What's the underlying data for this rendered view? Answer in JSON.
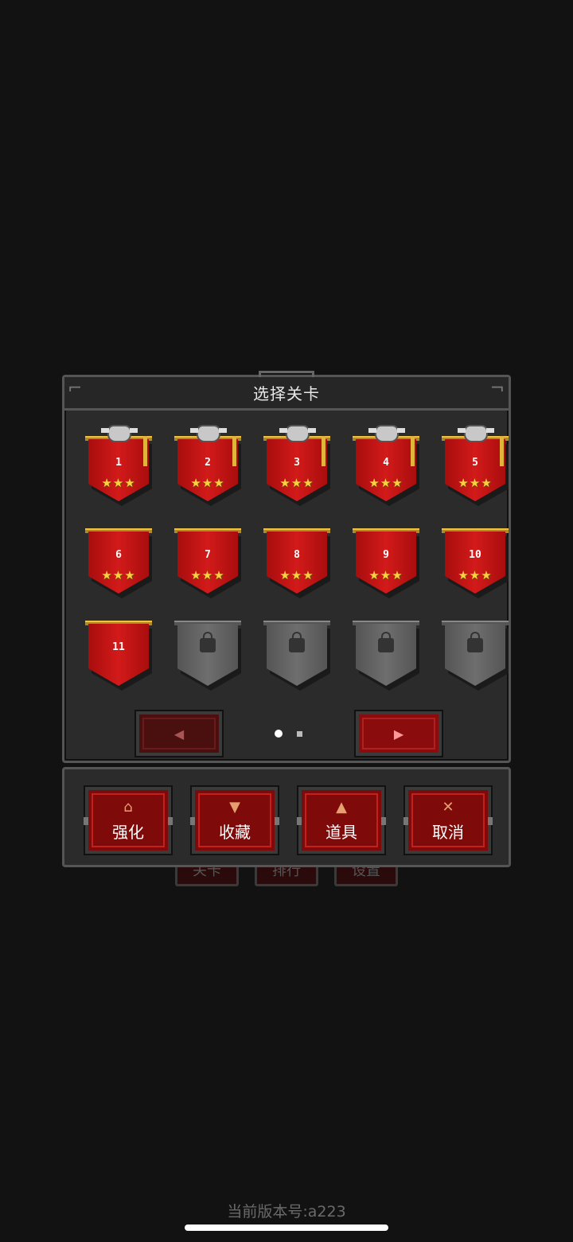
{
  "panel": {
    "title": "选择关卡"
  },
  "levels": [
    {
      "num": "1",
      "stars": "★★★",
      "state": "cleared",
      "boss": true
    },
    {
      "num": "2",
      "stars": "★★★",
      "state": "cleared",
      "boss": true
    },
    {
      "num": "3",
      "stars": "★★★",
      "state": "cleared",
      "boss": true
    },
    {
      "num": "4",
      "stars": "★★★",
      "state": "cleared",
      "boss": true
    },
    {
      "num": "5",
      "stars": "★★★",
      "state": "cleared",
      "boss": true
    },
    {
      "num": "6",
      "stars": "★★★",
      "state": "cleared",
      "boss": false
    },
    {
      "num": "7",
      "stars": "★★★",
      "state": "cleared",
      "boss": false
    },
    {
      "num": "8",
      "stars": "★★★",
      "state": "cleared",
      "boss": false
    },
    {
      "num": "9",
      "stars": "★★★",
      "state": "cleared",
      "boss": false
    },
    {
      "num": "10",
      "stars": "★★★",
      "state": "cleared",
      "boss": false
    },
    {
      "num": "11",
      "stars": "",
      "state": "unlocked",
      "boss": false
    },
    {
      "num": "",
      "stars": "",
      "state": "locked",
      "boss": false
    },
    {
      "num": "",
      "stars": "",
      "state": "locked",
      "boss": false
    },
    {
      "num": "",
      "stars": "",
      "state": "locked",
      "boss": false
    },
    {
      "num": "",
      "stars": "",
      "state": "locked",
      "boss": false
    }
  ],
  "pager": {
    "prev_icon": "◀",
    "next_icon": "▶",
    "current_page": 1,
    "total_pages": 2
  },
  "actions": [
    {
      "label": "强化",
      "icon": "⌂",
      "icon_name": "upgrade-icon"
    },
    {
      "label": "收藏",
      "icon": "▼",
      "icon_name": "trophy-icon"
    },
    {
      "label": "道具",
      "icon": "▲",
      "icon_name": "potion-icon"
    },
    {
      "label": "取消",
      "icon": "✕",
      "icon_name": "cancel-icon"
    }
  ],
  "background_buttons": [
    "关卡",
    "排行",
    "设置"
  ],
  "version": "当前版本号:a223",
  "colors": {
    "banner_red": "#d31a1a",
    "banner_locked": "#6e6e6e",
    "star": "#ffd23d",
    "panel": "#2b2b2b"
  }
}
